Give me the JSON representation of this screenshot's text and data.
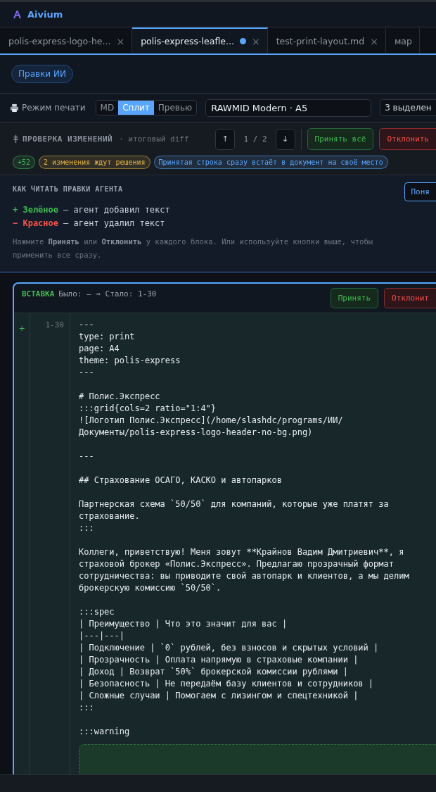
{
  "app": {
    "title": "Aivium"
  },
  "tabs": [
    {
      "label": "polis-express-logo-he...",
      "selected": false,
      "modified": false,
      "close": "×"
    },
    {
      "label": "polis-express-leafle...",
      "selected": true,
      "modified": true,
      "close": "×"
    },
    {
      "label": "test-print-layout.md",
      "selected": false,
      "modified": false,
      "close": "×"
    },
    {
      "label": "мар",
      "selected": false,
      "modified": false
    }
  ],
  "chip": "Правки ИИ",
  "toolbar": {
    "print_mode": "Режим печати",
    "views": [
      {
        "label": "MD",
        "selected": false
      },
      {
        "label": "Сплит",
        "selected": true
      },
      {
        "label": "Превью",
        "selected": false
      }
    ],
    "theme_select": "RAWMID Modern · A5",
    "selection": "3 выделен"
  },
  "review": {
    "title": "ПРОВЕРКА ИЗМЕНЕНИЙ",
    "subtitle": "· итоговый diff",
    "prev": "↑",
    "counter": "1 / 2",
    "next": "↓",
    "accept_all": "Принять всё",
    "reject_all": "Отклонить",
    "badges": [
      {
        "text": "+52",
        "color": "#3fb950"
      },
      {
        "text": "2 изменения ждут решения",
        "color": "#e3b341"
      },
      {
        "text": "Принятая строка сразу встаёт в документ на своё место",
        "color": "#58a6ff"
      }
    ]
  },
  "help": {
    "title": "КАК ЧИТАТЬ ПРАВКИ АГЕНТА",
    "dismiss": "Поня",
    "legend": [
      {
        "kind": "added",
        "marker": "+",
        "term": "Зелёное",
        "text": "— агент добавил текст"
      },
      {
        "kind": "removed",
        "marker": "−",
        "term": "Красное",
        "text": "— агент удалил текст"
      }
    ],
    "note": "Нажмите **Принять** или **Отклонить** у каждого блока. Или используйте кнопки выше, чтобы применить все сразу."
  },
  "hunk": {
    "kind": "ВСТАВКА",
    "range": "Было: — → Стало: 1-30",
    "accept": "Принять",
    "reject": "Отклонит",
    "gutter": "+",
    "lines": "1-30",
    "code": "---\ntype: print\npage: A4\ntheme: polis-express\n---\n\n# Полис.Экспресс\n:::grid{cols=2 ratio=\"1:4\"}\n![Логотип Полис.Экспресс](/home/slashdc/programs/ИИ/Документы/polis-express-logo-header-no-bg.png)\n\n---\n\n## Страхование ОСАГО, КАСКО и автопарков\n\nПартнерская схема `50/50` для компаний, которые уже платят за страхование.\n:::\n\nКоллеги, приветствую! Меня зовут **Крайнов Вадим Дмитриевич**, я страховой брокер «Полис.Экспресс». Предлагаю прозрачный формат сотрудничества: вы приводите свой автопарк и клиентов, а мы делим брокерскую комиссию `50/50`.\n\n:::spec\n| Преимущество | Что это значит для вас |\n|---|---|\n| Подключение | `0` рублей, без взносов и скрытых условий |\n| Прозрачность | Оплата напрямую в страховые компании |\n| Доход | Возврат `50%` брокерской комиссии рублями |\n| Безопасность | Не передаём базу клиентов и сотрудников |\n| Сложные случаи | Помогаем с лизингом и спецтехникой |\n:::\n\n:::warning"
  }
}
